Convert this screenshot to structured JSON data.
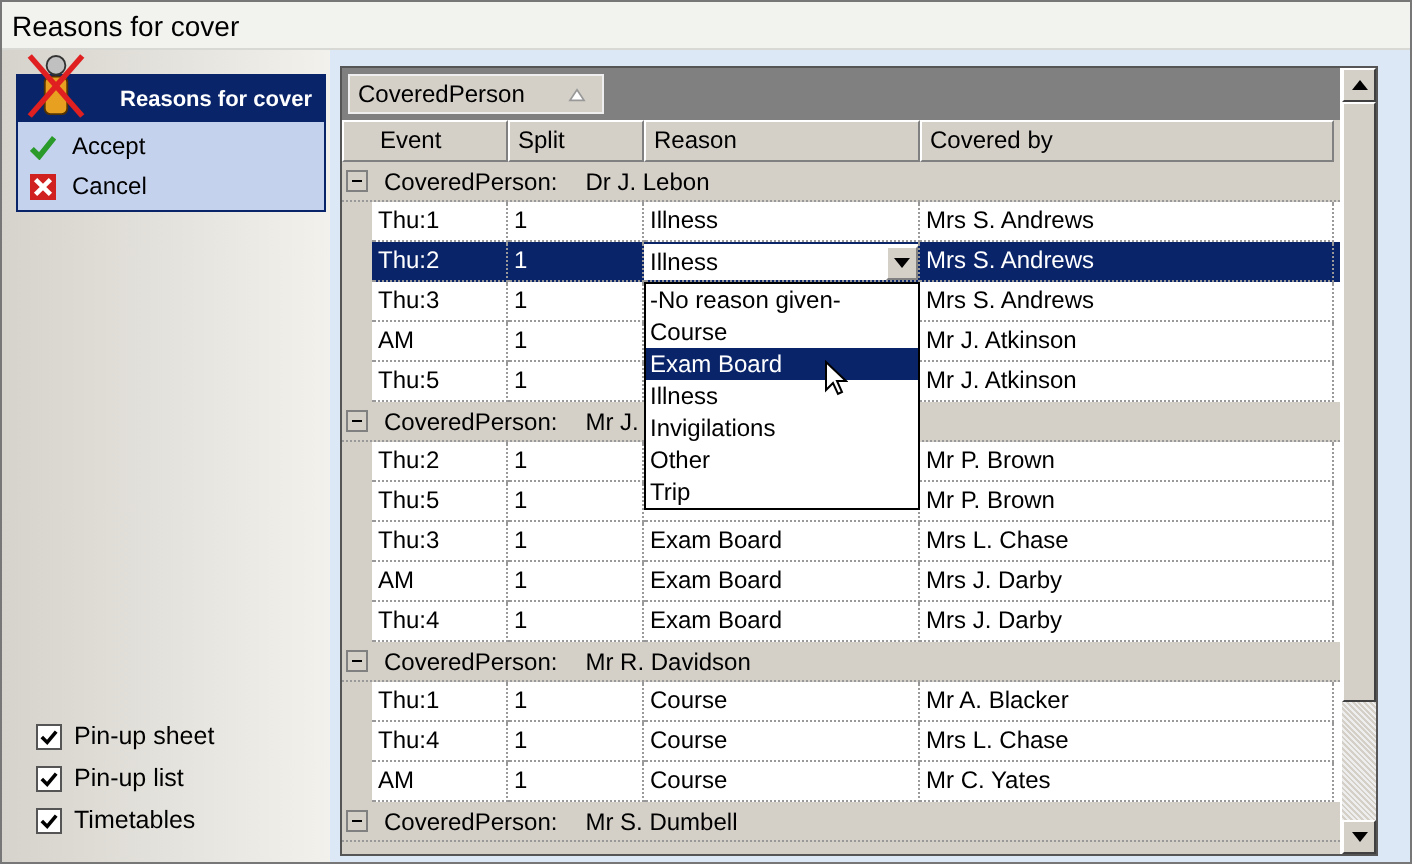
{
  "window": {
    "title": "Reasons for cover"
  },
  "panel": {
    "title": "Reasons for cover",
    "actions": [
      {
        "label": "Accept",
        "kind": "accept"
      },
      {
        "label": "Cancel",
        "kind": "cancel"
      }
    ]
  },
  "options": [
    {
      "label": "Pin-up sheet",
      "checked": true
    },
    {
      "label": "Pin-up list",
      "checked": true
    },
    {
      "label": "Timetables",
      "checked": true
    }
  ],
  "grid": {
    "group_by": "CoveredPerson",
    "columns": [
      "Event",
      "Split",
      "Reason",
      "Covered by"
    ],
    "groups": [
      {
        "label": "CoveredPerson:",
        "value": "Dr J. Lebon",
        "expanded": true,
        "rows": [
          {
            "event": "Thu:1",
            "split": "1",
            "reason": "Illness",
            "covered_by": "Mrs S. Andrews",
            "selected": false
          },
          {
            "event": "Thu:2",
            "split": "1",
            "reason": "Illness",
            "covered_by": "Mrs S. Andrews",
            "selected": true
          },
          {
            "event": "Thu:3",
            "split": "1",
            "covered_by": "Mrs S. Andrews",
            "selected": false
          },
          {
            "event": "AM",
            "split": "1",
            "covered_by": "Mr J. Atkinson",
            "selected": false
          },
          {
            "event": "Thu:5",
            "split": "1",
            "covered_by": "Mr J. Atkinson",
            "selected": false
          }
        ]
      },
      {
        "label": "CoveredPerson:",
        "value": "Mr J.",
        "expanded": true,
        "rows": [
          {
            "event": "Thu:2",
            "split": "1",
            "covered_by": "Mr P. Brown",
            "selected": false
          },
          {
            "event": "Thu:5",
            "split": "1",
            "covered_by": "Mr P. Brown",
            "selected": false
          },
          {
            "event": "Thu:3",
            "split": "1",
            "reason": "Exam Board",
            "covered_by": "Mrs L. Chase",
            "selected": false
          },
          {
            "event": "AM",
            "split": "1",
            "reason": "Exam Board",
            "covered_by": "Mrs J. Darby",
            "selected": false
          },
          {
            "event": "Thu:4",
            "split": "1",
            "reason": "Exam Board",
            "covered_by": "Mrs J. Darby",
            "selected": false
          }
        ]
      },
      {
        "label": "CoveredPerson:",
        "value": "Mr R. Davidson",
        "expanded": true,
        "rows": [
          {
            "event": "Thu:1",
            "split": "1",
            "reason": "Course",
            "covered_by": "Mr A. Blacker",
            "selected": false
          },
          {
            "event": "Thu:4",
            "split": "1",
            "reason": "Course",
            "covered_by": "Mrs L. Chase",
            "selected": false
          },
          {
            "event": "AM",
            "split": "1",
            "reason": "Course",
            "covered_by": "Mr C. Yates",
            "selected": false
          }
        ]
      },
      {
        "label": "CoveredPerson:",
        "value": "Mr S. Dumbell",
        "expanded": true
      }
    ],
    "dropdown": [
      {
        "label": "-No reason given-",
        "selected": false
      },
      {
        "label": "Course",
        "selected": false
      },
      {
        "label": "Exam Board",
        "selected": true
      },
      {
        "label": "Illness",
        "selected": false
      },
      {
        "label": "Invigilations",
        "selected": false
      },
      {
        "label": "Other",
        "selected": false
      },
      {
        "label": "Trip",
        "selected": false
      }
    ]
  }
}
